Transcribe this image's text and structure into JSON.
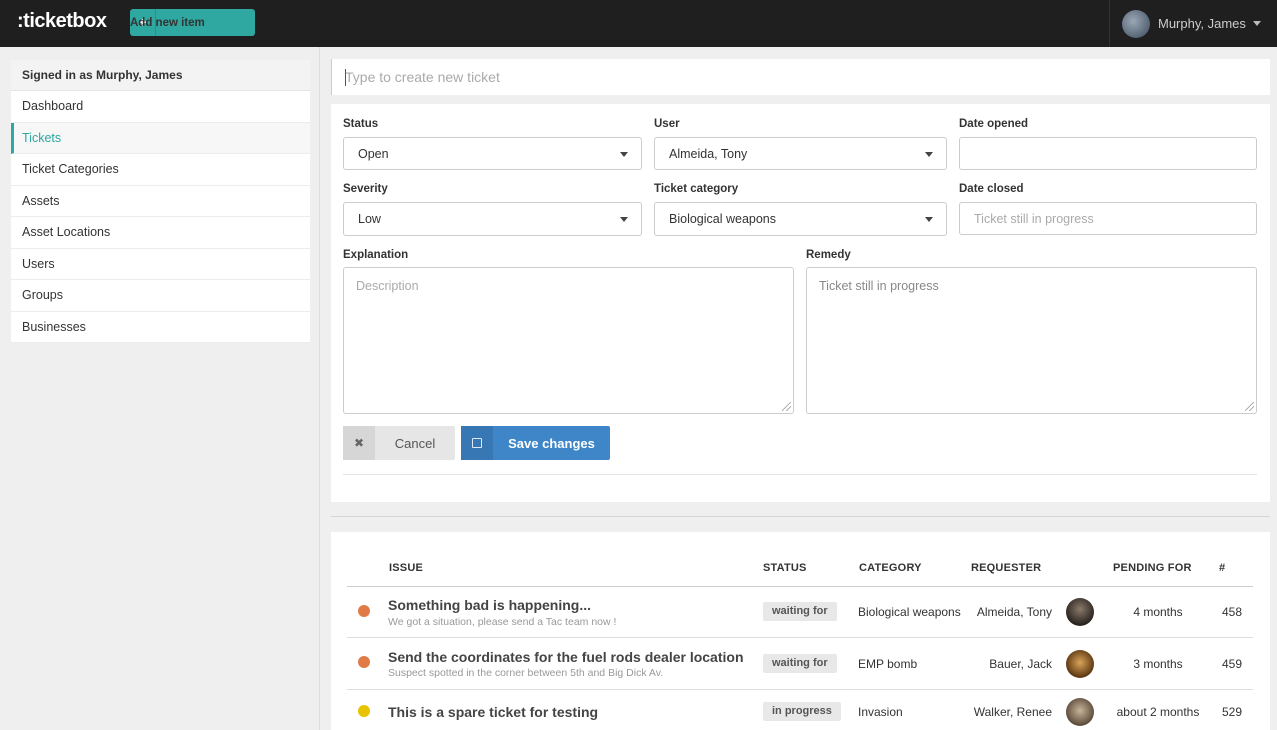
{
  "app": {
    "logo": ":ticketbox",
    "add_item": {
      "icon": "plus-icon",
      "label": "Add new item"
    },
    "user_menu": {
      "name": "Murphy, James"
    }
  },
  "sidebar": {
    "signed_in": "Signed in as Murphy, James",
    "items": [
      {
        "label": "Dashboard",
        "active": false
      },
      {
        "label": "Tickets",
        "active": true
      },
      {
        "label": "Ticket Categories",
        "active": false
      },
      {
        "label": "Assets",
        "active": false
      },
      {
        "label": "Asset Locations",
        "active": false
      },
      {
        "label": "Users",
        "active": false
      },
      {
        "label": "Groups",
        "active": false
      },
      {
        "label": "Businesses",
        "active": false
      }
    ]
  },
  "new_ticket": {
    "placeholder": "Type to create new ticket",
    "value": ""
  },
  "form": {
    "status": {
      "label": "Status",
      "value": "Open"
    },
    "user": {
      "label": "User",
      "value": "Almeida, Tony"
    },
    "date_opened": {
      "label": "Date opened",
      "value": ""
    },
    "severity": {
      "label": "Severity",
      "value": "Low"
    },
    "ticket_category": {
      "label": "Ticket category",
      "value": "Biological weapons"
    },
    "date_closed": {
      "label": "Date closed",
      "placeholder": "Ticket still in progress"
    },
    "explanation": {
      "label": "Explanation",
      "placeholder": "Description"
    },
    "remedy": {
      "label": "Remedy",
      "placeholder": "Ticket still in progress"
    },
    "cancel": {
      "icon": "close-icon",
      "label": "Cancel"
    },
    "save": {
      "icon": "floppy-disk-icon",
      "label": "Save changes"
    }
  },
  "tickets": {
    "columns": [
      "ISSUE",
      "STATUS",
      "CATEGORY",
      "REQUESTER",
      "PENDING FOR",
      "#"
    ],
    "rows": [
      {
        "title": "Something bad is happening...",
        "subtitle": "We got a situation, please send a Tac team now !",
        "status": "waiting for",
        "category": "Biological weapons",
        "requester": "Almeida, Tony",
        "pending": "4 months",
        "id": "458",
        "dot_color": "#e07b47"
      },
      {
        "title": "Send the coordinates for the fuel rods dealer location",
        "subtitle": "Suspect spotted in the corner between 5th and Big Dick Av.",
        "status": "waiting for",
        "category": "EMP bomb",
        "requester": "Bauer, Jack",
        "pending": "3 months",
        "id": "459",
        "dot_color": "#e07b47"
      },
      {
        "title": "This is a spare ticket for testing",
        "subtitle": "",
        "status": "in progress",
        "category": "Invasion",
        "requester": "Walker, Renee",
        "pending": "about 2 months",
        "id": "529",
        "dot_color": "#e8c400"
      }
    ]
  },
  "colors": {
    "accent": "#2ea8a0",
    "primary": "#3e86c8",
    "topbar": "#1f1f1f"
  }
}
